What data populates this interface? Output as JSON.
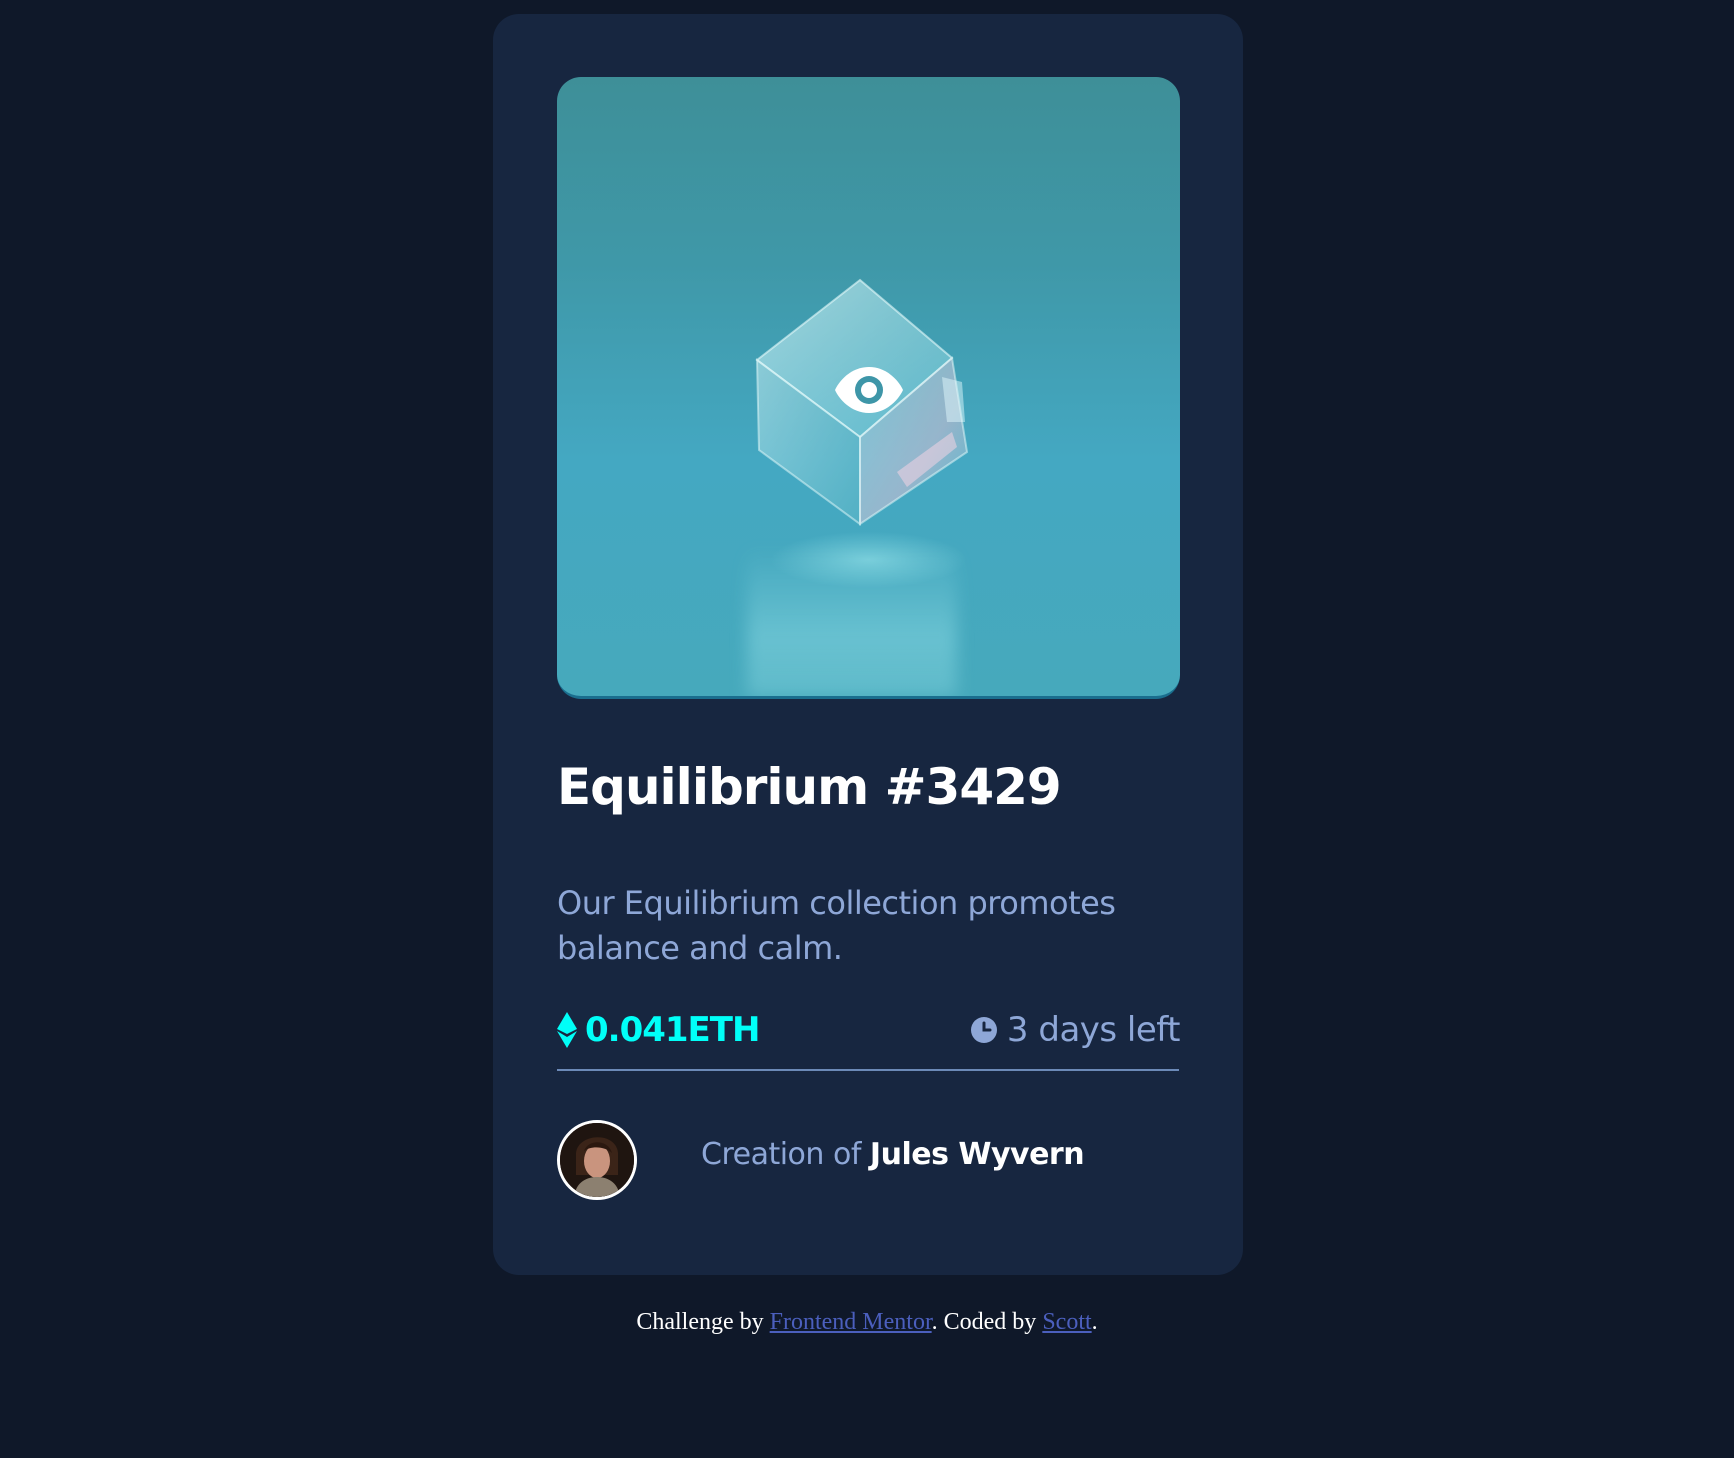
{
  "card": {
    "image_overlay_icon": "view-icon",
    "title": "Equilibrium #3429",
    "description": "Our Equilibrium collection promotes balance and calm.",
    "price": {
      "icon": "ethereum-icon",
      "value": "0.041ETH"
    },
    "time_left": {
      "icon": "clock-icon",
      "value": "3 days left"
    },
    "creator": {
      "prefix": "Creation of ",
      "name": "Jules Wyvern"
    }
  },
  "footer": {
    "text_1": "Challenge by ",
    "link_1": "Frontend Mentor",
    "text_2": ". Coded by ",
    "link_2": "Scott",
    "text_3": "."
  },
  "colors": {
    "page_background": "#0f1829",
    "card_background": "#172640",
    "accent_cyan": "#00fff8",
    "soft_blue": "#8ea7d7",
    "white": "#ffffff",
    "link": "#4b5fbd"
  }
}
